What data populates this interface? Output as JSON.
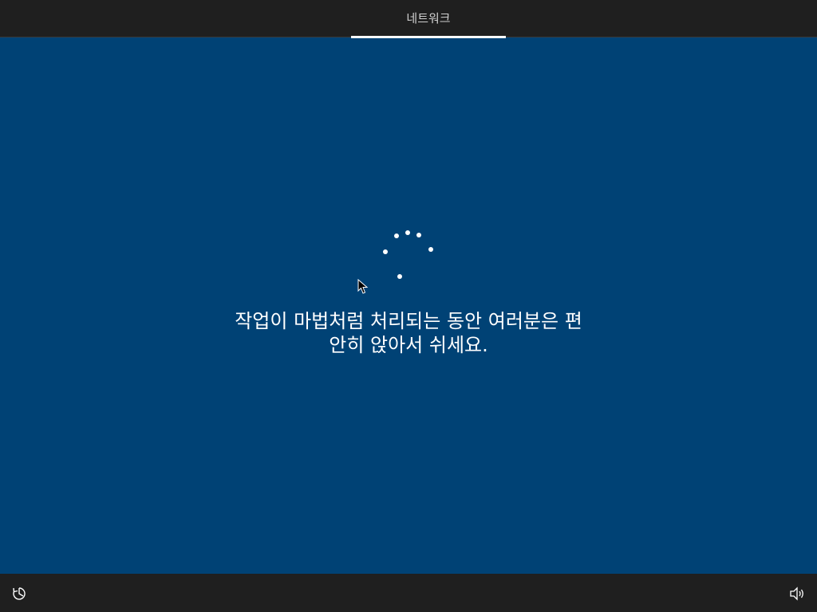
{
  "header": {
    "active_tab": "네트워크"
  },
  "main": {
    "message_line1": "작업이 마법처럼 처리되는 동안 여러분은 편",
    "message_line2": "안히 앉아서 쉬세요."
  },
  "icons": {
    "spinner": "loading-spinner-icon",
    "ease_of_access": "ease-of-access-icon",
    "volume": "volume-icon"
  },
  "colors": {
    "background": "#004275",
    "bars": "#1f1f1f",
    "text": "#ffffff"
  }
}
